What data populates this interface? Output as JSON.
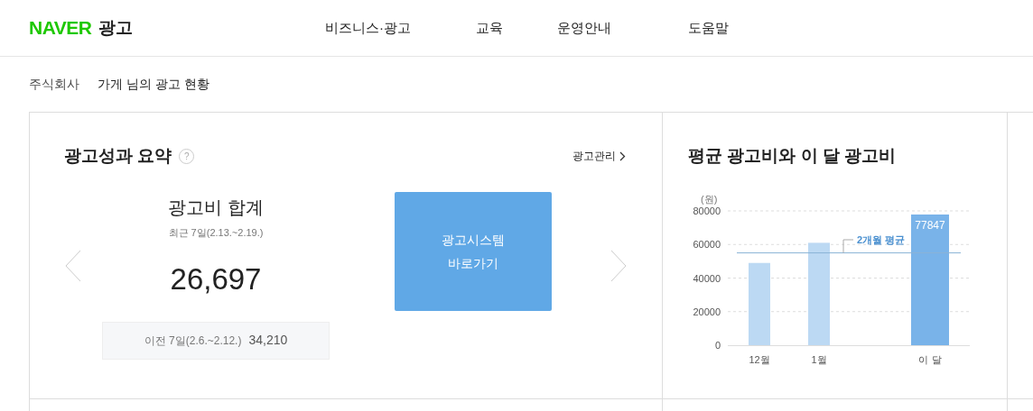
{
  "header": {
    "logo": "NAVER",
    "logo_suffix": "광고",
    "nav": [
      {
        "label": "비즈니스·광고"
      },
      {
        "label": "교육"
      },
      {
        "label": "운영안내"
      },
      {
        "label": "도움말"
      }
    ]
  },
  "breadcrumb": {
    "company": "주식회사",
    "title": "가게 님의 광고 현황"
  },
  "summary": {
    "title": "광고성과 요약",
    "help": "?",
    "manage_link": "광고관리",
    "stat_title": "광고비 합계",
    "period": "최근 7일(2.13.~2.19.)",
    "value": "26,697",
    "previous_label": "이전 7일(2.6.~2.12.)",
    "previous_value": "34,210",
    "cta": "광고시스템\n바로가기"
  },
  "spend_chart": {
    "title": "평균 광고비와 이 달 광고비",
    "chart_data": {
      "type": "bar",
      "ylabel": "(원)",
      "categories": [
        "12월",
        "1월",
        "이 달"
      ],
      "stacked": true,
      "series": [
        {
          "color": "#bcd9f3",
          "values": [
            49000,
            61000,
            null
          ]
        },
        {
          "color": "#79b3e9",
          "values": [
            null,
            null,
            77847
          ]
        }
      ],
      "ylim": [
        0,
        80000
      ],
      "yticks": [
        0,
        20000,
        40000,
        60000,
        80000
      ],
      "value_labels": [
        null,
        null,
        "77847"
      ],
      "grid": true,
      "ref_lines": [
        {
          "axis": "y",
          "value": 55000,
          "label": "2개월 평균"
        }
      ]
    }
  }
}
